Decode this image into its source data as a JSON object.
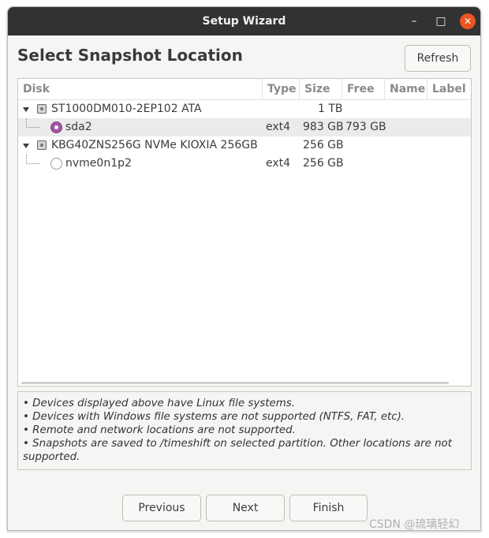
{
  "window": {
    "title": "Setup Wizard",
    "minimize_glyph": "–",
    "maximize_glyph": "□",
    "close_glyph": "✕"
  },
  "page": {
    "heading": "Select Snapshot Location",
    "refresh_label": "Refresh"
  },
  "table": {
    "columns": [
      "Disk",
      "Type",
      "Size",
      "Free",
      "Name",
      "Label"
    ],
    "rows": [
      {
        "kind": "disk",
        "name": "ST1000DM010-2EP102 ATA",
        "type": "",
        "size": "1 TB",
        "free": "",
        "selected": false
      },
      {
        "kind": "partition",
        "name": "sda2",
        "type": "ext4",
        "size": "983 GB",
        "free": "793 GB",
        "selected": true
      },
      {
        "kind": "disk",
        "name": "KBG40ZNS256G NVMe KIOXIA 256GB",
        "type": "",
        "size": "256 GB",
        "free": "",
        "selected": false
      },
      {
        "kind": "partition",
        "name": "nvme0n1p2",
        "type": "ext4",
        "size": "256 GB",
        "free": "",
        "selected": false
      }
    ]
  },
  "notes": [
    "• Devices displayed above have Linux file systems.",
    "• Devices with Windows file systems are not supported (NTFS, FAT, etc).",
    "• Remote and network locations are not supported.",
    "• Snapshots are saved to /timeshift on selected partition. Other locations are not supported."
  ],
  "footer": {
    "previous_label": "Previous",
    "next_label": "Next",
    "finish_label": "Finish"
  },
  "watermark": "CSDN @琉璃轻幻",
  "colors": {
    "titlebar": "#323232",
    "close_button": "#e95420",
    "radio_selected": "#a3549f",
    "selected_row": "#ebebeb"
  }
}
